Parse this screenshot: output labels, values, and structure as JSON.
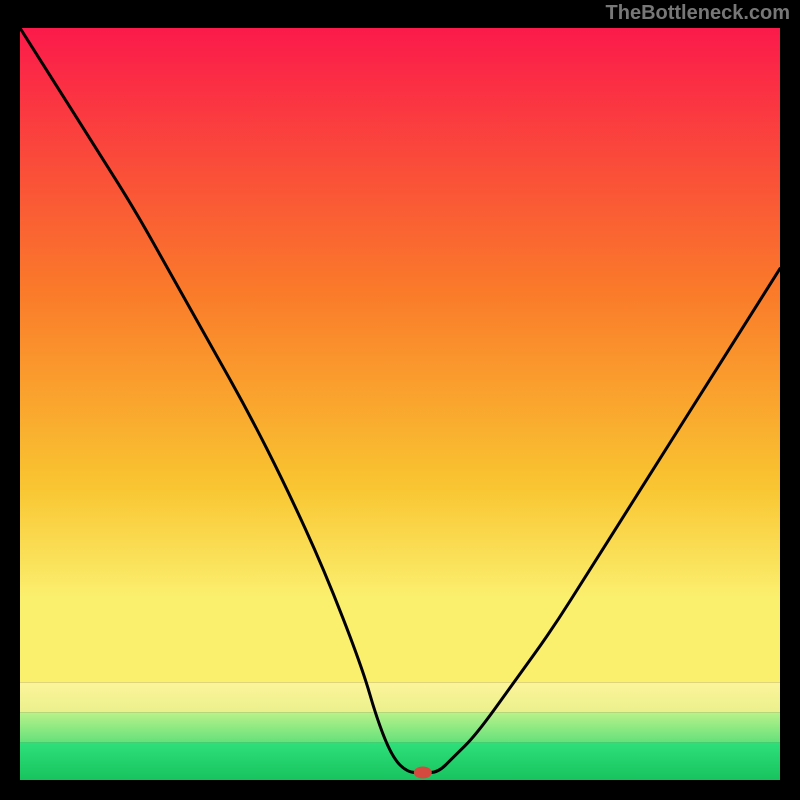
{
  "watermark": "TheBottleneck.com",
  "chart_data": {
    "type": "line",
    "title": "",
    "xlabel": "",
    "ylabel": "",
    "xlim": [
      0,
      100
    ],
    "ylim": [
      0,
      100
    ],
    "x": [
      0,
      5,
      10,
      15,
      20,
      25,
      30,
      35,
      40,
      45,
      47,
      49,
      51,
      53,
      55,
      57,
      60,
      65,
      70,
      75,
      80,
      85,
      90,
      95,
      100
    ],
    "values": [
      100,
      92,
      84,
      76,
      67,
      58,
      49,
      39,
      28,
      15,
      8,
      3,
      1,
      1,
      1,
      3,
      6,
      13,
      20,
      28,
      36,
      44,
      52,
      60,
      68
    ],
    "minimum_x": 53,
    "marker": {
      "x": 53,
      "y": 1,
      "color": "#d44a3f"
    },
    "bands": [
      {
        "name": "green",
        "from": 0,
        "to": 5,
        "color_top": "#2fe07a",
        "color_bottom": "#17c35e"
      },
      {
        "name": "lightgreen",
        "from": 5,
        "to": 9,
        "color_top": "#b9f28a",
        "color_bottom": "#65e17b"
      },
      {
        "name": "lemon",
        "from": 9,
        "to": 13,
        "color_top": "#fdf49a",
        "color_bottom": "#eaf08c"
      },
      {
        "name": "gradient",
        "from": 13,
        "to": 100
      }
    ],
    "gradient_stops": [
      {
        "pct": 0,
        "color": "#fb1a4b"
      },
      {
        "pct": 40,
        "color": "#fa7a2a"
      },
      {
        "pct": 70,
        "color": "#f9c531"
      },
      {
        "pct": 87,
        "color": "#fbef6e"
      }
    ]
  }
}
